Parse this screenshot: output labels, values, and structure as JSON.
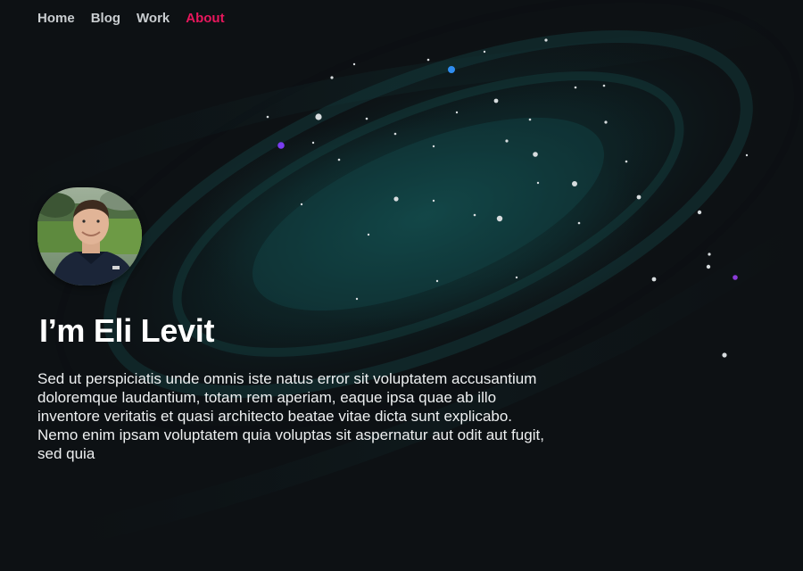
{
  "nav": {
    "items": [
      {
        "label": "Home",
        "active": false
      },
      {
        "label": "Blog",
        "active": false
      },
      {
        "label": "Work",
        "active": false
      },
      {
        "label": "About",
        "active": true
      }
    ],
    "active_color": "#e8175d"
  },
  "profile": {
    "headline": "I’m Eli Levit",
    "bio": "Sed ut perspiciatis unde omnis iste natus error sit voluptatem accusantium doloremque laudantium, totam rem aperiam, eaque ipsa quae ab illo inventore veritatis et quasi architecto beatae vitae dicta sunt explicabo. Nemo enim ipsam voluptatem quia voluptas sit aspernatur aut odit aut fugit, sed quia"
  },
  "theme": {
    "background": "#0d1114",
    "galaxy_glow": "#0f4c4c",
    "star_blue": "#2f8df0",
    "star_purple": "#7a3cf0"
  }
}
